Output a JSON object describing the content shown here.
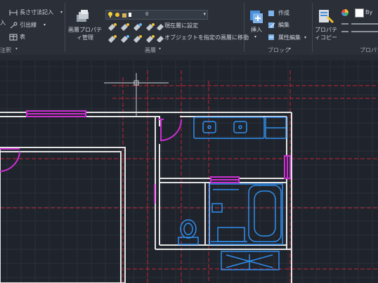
{
  "ribbon": {
    "annotate": {
      "cut_left_text": "入",
      "linear_dim": "長さ寸法記入",
      "leader": "引出線",
      "table": "表",
      "panel_label": "注釈"
    },
    "layers": {
      "properties_label": "画層プロパティ管理",
      "current_layer": "0",
      "make_current": "現在層に設定",
      "move_to_layer": "オブジェクトを指定の画層に移動",
      "panel_label": "画層"
    },
    "block": {
      "insert": "挿入",
      "create": "作成",
      "edit": "編集",
      "attr_edit": "属性編集",
      "panel_label": "ブロック"
    },
    "properties": {
      "match_props": "プロパティコピー",
      "bylayer": "By",
      "panel_label": "プロパティ"
    }
  },
  "colors": {
    "wall": "#e4e4e4",
    "door_magenta": "#cc2fd0",
    "fixture_blue": "#2e8ff0",
    "grid_red": "#c0263a",
    "background": "#1f232b"
  }
}
